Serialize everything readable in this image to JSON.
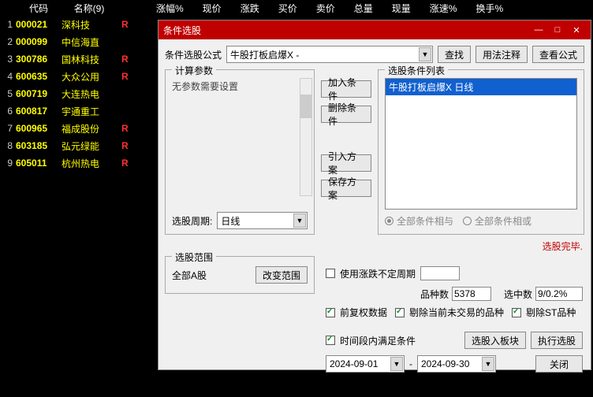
{
  "table": {
    "headers": {
      "code": "代码",
      "name": "名称(9)",
      "pct": "涨幅%",
      "price": "现价",
      "chg": "涨跌",
      "bid": "买价",
      "ask": "卖价",
      "vol": "总量",
      "cur": "现量",
      "speed": "涨速%",
      "turn": "换手%"
    },
    "rows": [
      {
        "idx": "1",
        "code": "000021",
        "name": "深科技",
        "r": "R"
      },
      {
        "idx": "2",
        "code": "000099",
        "name": "中信海直",
        "r": ""
      },
      {
        "idx": "3",
        "code": "300786",
        "name": "国林科技",
        "r": "R"
      },
      {
        "idx": "4",
        "code": "600635",
        "name": "大众公用",
        "r": "R"
      },
      {
        "idx": "5",
        "code": "600719",
        "name": "大连热电",
        "r": ""
      },
      {
        "idx": "6",
        "code": "600817",
        "name": "宇通重工",
        "r": ""
      },
      {
        "idx": "7",
        "code": "600965",
        "name": "福成股份",
        "r": "R"
      },
      {
        "idx": "8",
        "code": "603185",
        "name": "弘元绿能",
        "r": "R"
      },
      {
        "idx": "9",
        "code": "605011",
        "name": "杭州热电",
        "r": "R"
      }
    ]
  },
  "dialog": {
    "title": "条件选股",
    "formula_lbl": "条件选股公式",
    "formula_val": "牛股打板启爆X -",
    "btn_search": "查找",
    "btn_usage": "用法注释",
    "btn_view": "查看公式",
    "fs_params": "计算参数",
    "no_params": "无参数需要设置",
    "period_lbl": "选股周期:",
    "period_val": "日线",
    "btn_add": "加入条件",
    "btn_del": "删除条件",
    "btn_import": "引入方案",
    "btn_save": "保存方案",
    "fs_cond": "选股条件列表",
    "cond_item": "牛股打板启爆X  日线",
    "radio_and": "全部条件相与",
    "radio_or": "全部条件相或",
    "status": "选股完毕.",
    "fs_scope": "选股范围",
    "scope_val": "全部A股",
    "btn_scope": "改变范围",
    "chk_undet": "使用涨跌不定周期",
    "cnt_lbl1": "品种数",
    "cnt_val1": "5378",
    "cnt_lbl2": "选中数",
    "cnt_val2": "9/0.2%",
    "chk_fq": "前复权数据",
    "chk_rm": "剔除当前未交易的品种",
    "chk_st": "剔除ST品种",
    "chk_time": "时间段内满足条件",
    "btn_block": "选股入板块",
    "btn_exec": "执行选股",
    "date_from": "2024-09-01",
    "date_sep": "-",
    "date_to": "2024-09-30",
    "btn_close": "关闭"
  }
}
